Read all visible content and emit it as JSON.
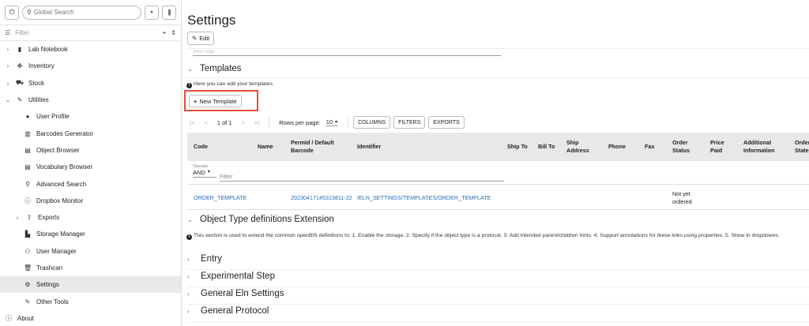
{
  "sidebar": {
    "search_placeholder": "Global Search",
    "filter_placeholder": "Filter",
    "items": [
      {
        "label": "Lab Notebook",
        "icon": "notebook-icon",
        "level": 0,
        "chevron": "›"
      },
      {
        "label": "Inventory",
        "icon": "cubes-icon",
        "level": 0,
        "chevron": "›"
      },
      {
        "label": "Stock",
        "icon": "cart-icon",
        "level": 0,
        "chevron": "›"
      },
      {
        "label": "Utilities",
        "icon": "wrench-icon",
        "level": 0,
        "chevron": "⌄"
      },
      {
        "label": "User Profile",
        "icon": "user-icon",
        "level": 1
      },
      {
        "label": "Barcodes Generator",
        "icon": "barcode-icon",
        "level": 1
      },
      {
        "label": "Object Browser",
        "icon": "table-icon",
        "level": 1
      },
      {
        "label": "Vocabulary Browser",
        "icon": "table-icon",
        "level": 1
      },
      {
        "label": "Advanced Search",
        "icon": "search-icon",
        "level": 1
      },
      {
        "label": "Dropbox Monitor",
        "icon": "info-icon",
        "level": 1
      },
      {
        "label": "Exports",
        "icon": "export-icon",
        "level": 1,
        "chevron": "›"
      },
      {
        "label": "Storage Manager",
        "icon": "file-icon",
        "level": 1
      },
      {
        "label": "User Manager",
        "icon": "users-icon",
        "level": 1
      },
      {
        "label": "Trashcan",
        "icon": "trash-icon",
        "level": 1
      },
      {
        "label": "Settings",
        "icon": "gear-icon",
        "level": 1,
        "active": true
      },
      {
        "label": "Other Tools",
        "icon": "wrench-icon",
        "level": 1
      },
      {
        "label": "About",
        "icon": "info-icon",
        "level": 0
      }
    ]
  },
  "main": {
    "title": "Settings",
    "edit_label": "Edit",
    "ghost_text": "AND   Filter",
    "templates": {
      "heading": "Templates",
      "info": "Here you can edit your templates.",
      "new_button": "New Template",
      "pager": {
        "page_label": "1 of 1",
        "rows_label": "Rows per page:",
        "rows_value": "10",
        "columns_btn": "COLUMNS",
        "filters_btn": "FILTERS",
        "exports_btn": "EXPORTS"
      },
      "columns": [
        "Code",
        "Name",
        "PermId / Default Barcode",
        "Identifier",
        "Ship To",
        "Bill To",
        "Ship Address",
        "Phone",
        "Fax",
        "Order Status",
        "Price Paid",
        "Additional Information",
        "Order State"
      ],
      "operator_label": "Operator",
      "operator_value": "AND",
      "filter_placeholder": "Filter",
      "row": {
        "code": "ORDER_TEMPLATE",
        "permid": "20230417145313811-22",
        "identifier": "/ELN_SETTINGS/TEMPLATES/ORDER_TEMPLATE",
        "order_status": "Not yet ordered"
      }
    },
    "ext": {
      "heading": "Object Type definitions Extension",
      "info": "This section is used to extend the common openBIS definitions to: 1. Enable the storage. 2. Specify if the object type is a protocol. 3. Add intended parent/children hints. 4. Support annotations for these links using properties. 5. Show in dropdowns.",
      "items": [
        "Entry",
        "Experimental Step",
        "General Eln Settings",
        "General Protocol"
      ]
    }
  }
}
